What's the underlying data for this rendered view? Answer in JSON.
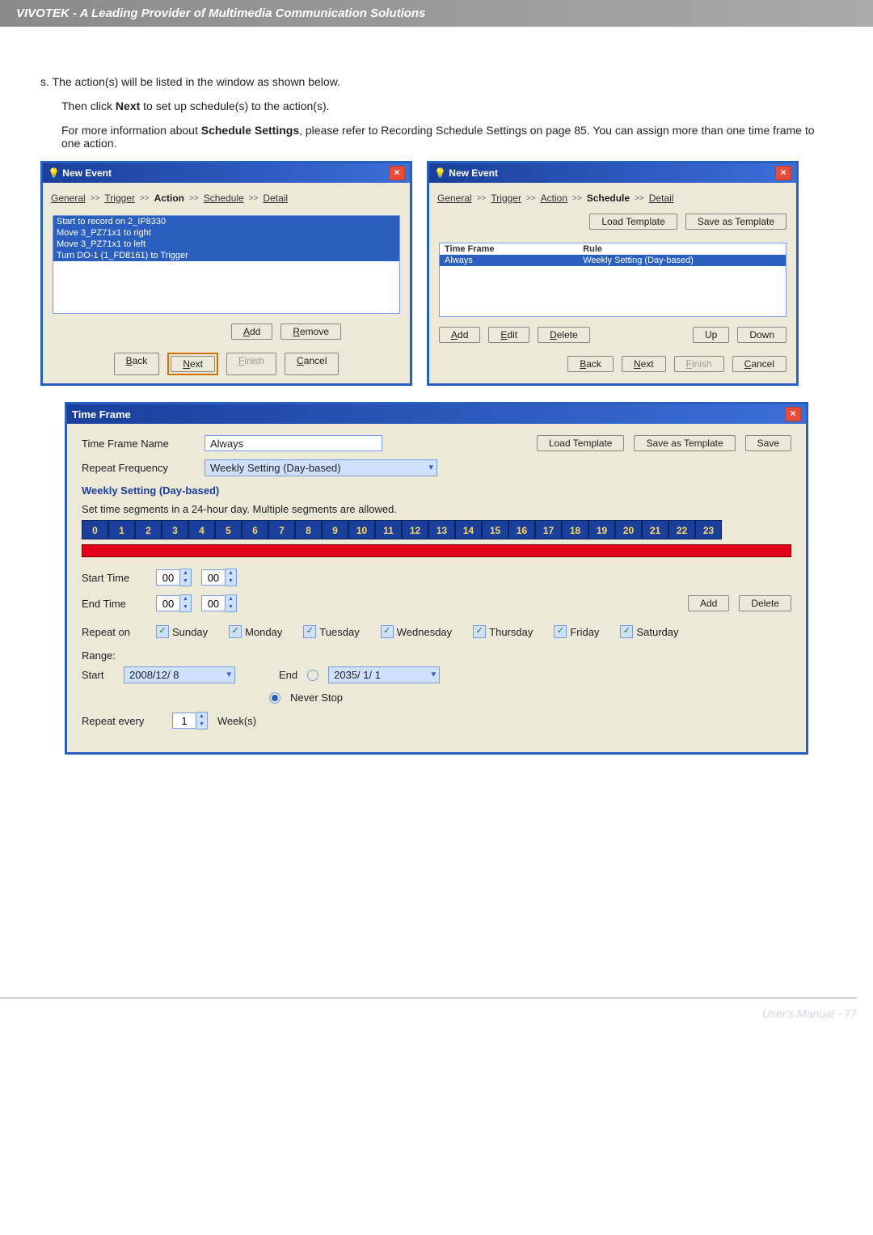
{
  "header": {
    "brand": "VIVOTEK - A Leading Provider of Multimedia Communication Solutions"
  },
  "step": {
    "marker": "s.",
    "line1": "The action(s) will be listed in the window as shown below.",
    "line2_a": "Then click ",
    "line2_b": "Next",
    "line2_c": " to set up schedule(s) to the action(s).",
    "line3_a": "For more information about ",
    "line3_b": "Schedule Settings",
    "line3_c": ", please refer to Recording Schedule Settings on page 85. You can assign more than one time frame to one action."
  },
  "dlg_left": {
    "title": "New Event",
    "crumbs": [
      "General",
      "Trigger",
      "Action",
      "Schedule",
      "Detail"
    ],
    "active_crumb": "Action",
    "list": [
      "Start to record on 2_IP8330",
      "Move 3_PZ71x1 to right",
      "Move 3_PZ71x1 to left",
      "Turn DO-1 (1_FD8161) to Trigger"
    ],
    "buttons": {
      "add": "Add",
      "remove": "Remove",
      "back": "Back",
      "next": "Next",
      "finish": "Finish",
      "cancel": "Cancel"
    }
  },
  "dlg_right": {
    "title": "New Event",
    "crumbs": [
      "General",
      "Trigger",
      "Action",
      "Schedule",
      "Detail"
    ],
    "active_crumb": "Schedule",
    "load_template": "Load Template",
    "save_template": "Save as Template",
    "table": {
      "cols": [
        "Time Frame",
        "Rule"
      ],
      "row": [
        "Always",
        "Weekly Setting (Day-based)"
      ]
    },
    "buttons": {
      "add": "Add",
      "edit": "Edit",
      "delete": "Delete",
      "up": "Up",
      "down": "Down",
      "back": "Back",
      "next": "Next",
      "finish": "Finish",
      "cancel": "Cancel"
    }
  },
  "tf": {
    "title": "Time Frame",
    "name_label": "Time Frame Name",
    "name_value": "Always",
    "load_template": "Load Template",
    "save_template": "Save as Template",
    "save": "Save",
    "repeat_freq_label": "Repeat Frequency",
    "repeat_freq_value": "Weekly Setting (Day-based)",
    "group_title": "Weekly Setting (Day-based)",
    "segments_hint": "Set time segments in a 24-hour day. Multiple segments are allowed.",
    "hours": [
      "0",
      "1",
      "2",
      "3",
      "4",
      "5",
      "6",
      "7",
      "8",
      "9",
      "10",
      "11",
      "12",
      "13",
      "14",
      "15",
      "16",
      "17",
      "18",
      "19",
      "20",
      "21",
      "22",
      "23"
    ],
    "start_time_label": "Start Time",
    "start_time_hh": "00",
    "start_time_mm": "00",
    "end_time_label": "End Time",
    "end_time_hh": "00",
    "end_time_mm": "00",
    "add": "Add",
    "delete": "Delete",
    "repeat_on_label": "Repeat on",
    "days": [
      "Sunday",
      "Monday",
      "Tuesday",
      "Wednesday",
      "Thursday",
      "Friday",
      "Saturday"
    ],
    "range_label": "Range:",
    "start_label": "Start",
    "start_value": "2008/12/ 8",
    "end_label": "End",
    "end_value": "2035/ 1/ 1",
    "never_stop": "Never Stop",
    "repeat_every_label": "Repeat every",
    "repeat_every_value": "1",
    "repeat_every_unit": "Week(s)"
  },
  "footer": {
    "text": "User's Manual - 77"
  }
}
